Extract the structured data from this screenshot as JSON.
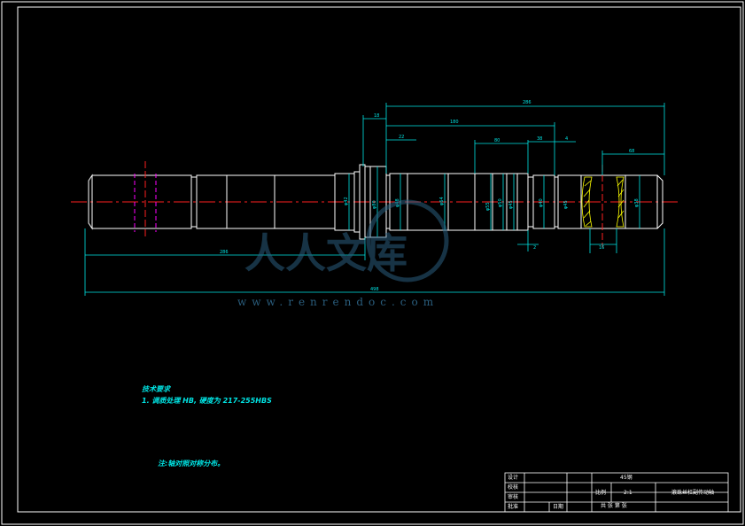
{
  "dimensions": {
    "top_overall": "286",
    "top_flange": "18",
    "top_span": "180",
    "top_sub": "22",
    "mid_a": "80",
    "mid_b": "38",
    "mid_c": "4",
    "right_end": "68",
    "bottom_left": "286",
    "overall_length": "498",
    "slot_width": "16",
    "small_gap": "2",
    "diameters": [
      "φ42",
      "φ80",
      "φ48",
      "φ64",
      "φ55",
      "φ50",
      "φ45",
      "φ40",
      "φ45",
      "φ38"
    ]
  },
  "notes": {
    "heading": "技术要求",
    "line1": "1. 调质处理 HB, 硬度为 217-255HBS",
    "remark": "注:轴对照对称分布。"
  },
  "title_block": {
    "designer_label": "设计",
    "checker_label": "校核",
    "reviewer_label": "审核",
    "approver_label": "批准",
    "material": "45钢",
    "scale_label": "比例",
    "scale_value": "2:1",
    "drawing_name": "滚珠丝杠副传动轴",
    "sheet_count": "共 张 第 张",
    "date_label": "日期"
  },
  "watermark": {
    "brand": "人人文库",
    "url": "www.renrendoc.com"
  },
  "colors": {
    "background": "#000000",
    "outline": "#ffffff",
    "dimension": "#00e5e5",
    "centerline": "#ff2020",
    "hatch": "#ffff00",
    "keyway": "#ff00ff",
    "watermark": "#2a5e7e"
  }
}
